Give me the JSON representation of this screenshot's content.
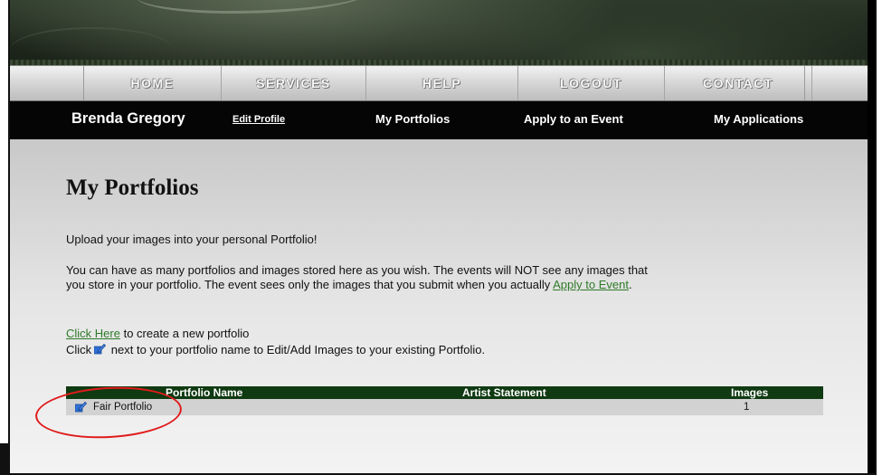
{
  "nav": {
    "items": [
      {
        "label": "HOME"
      },
      {
        "label": "SERVICES"
      },
      {
        "label": "HELP"
      },
      {
        "label": "LOGOUT"
      },
      {
        "label": "CONTACT"
      }
    ]
  },
  "userbar": {
    "user_name": "Brenda Gregory",
    "edit_profile": "Edit Profile",
    "my_portfolios": "My Portfolios",
    "apply_to_event": "Apply to an Event",
    "my_applications": "My Applications"
  },
  "page": {
    "title": "My Portfolios",
    "intro": "Upload your images into your personal Portfolio!",
    "info_line1": "You can have as many portfolios and images stored here as you wish. The events will NOT see any images that",
    "info_line2_prefix": "you store in your portfolio. The event sees only the images that you submit when you actually ",
    "info_link": "Apply to Event",
    "info_suffix": ".",
    "create_link": "Click Here",
    "create_suffix": " to create a new portfolio",
    "edit_prefix": "Click",
    "edit_suffix": " next to your portfolio name to Edit/Add Images to your existing Portfolio."
  },
  "table": {
    "headers": [
      "Portfolio Name",
      "Artist Statement",
      "Images"
    ],
    "rows": [
      {
        "name": "Fair Portfolio",
        "statement": "",
        "images": "1",
        "icon": "edit-icon"
      }
    ]
  },
  "colors": {
    "table_header": "#0f3a12",
    "link": "#2f7a2a",
    "highlight_circle": "#e01b1b"
  }
}
